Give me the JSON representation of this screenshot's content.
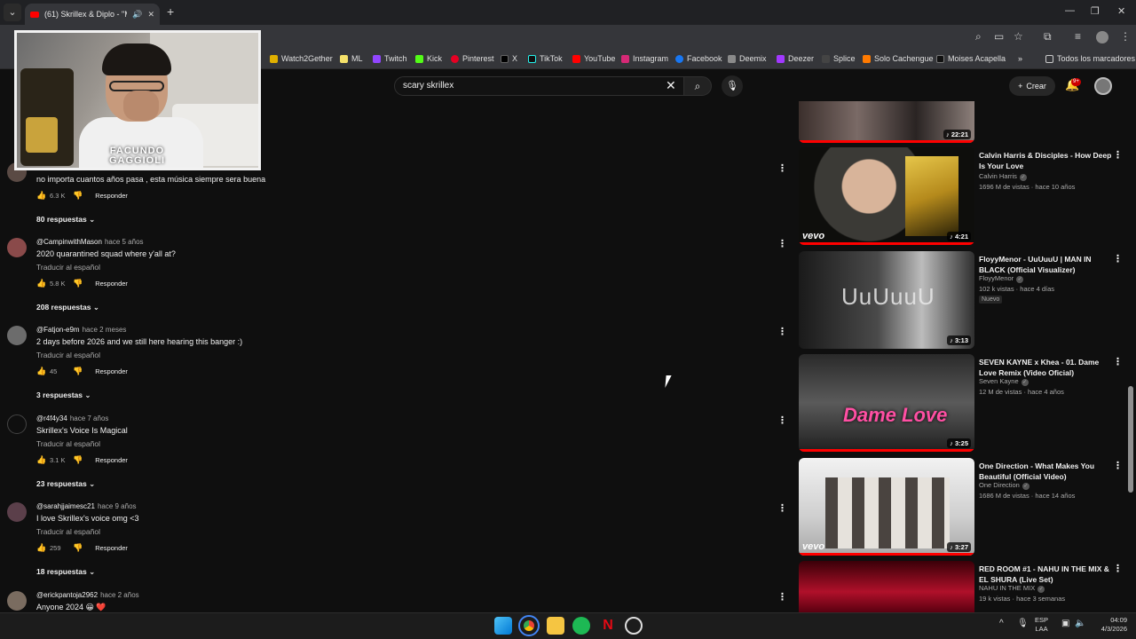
{
  "browser": {
    "tab_title": "(61) Skrillex & Diplo - \"Mind",
    "bookmarks": [
      "Watch2Gether",
      "ML",
      "Twitch",
      "Kick",
      "Pinterest",
      "X",
      "TikTok",
      "YouTube",
      "Instagram",
      "Facebook",
      "Deemix",
      "Deezer",
      "Splice",
      "Solo Cachengue",
      "Moises Acapella"
    ],
    "all_bookmarks": "Todos los marcadores"
  },
  "youtube": {
    "search_value": "scary skrillex",
    "create_label": "Crear",
    "notification_badge": "9+"
  },
  "webcam": {
    "name_line1": "FACUNDO",
    "name_line2": "GAGGIOLI"
  },
  "comments": [
    {
      "user": "",
      "time": "",
      "text": "no importa cuantos años pasa , esta música siempre sera buena",
      "translate": "",
      "likes": "6.3 K",
      "reply": "Responder",
      "replies": "80 respuestas"
    },
    {
      "user": "@CampinwithMason",
      "time": "hace 5 años",
      "text": "2020 quarantined squad where y'all at?",
      "translate": "Traducir al español",
      "likes": "5.8 K",
      "reply": "Responder",
      "replies": "208 respuestas"
    },
    {
      "user": "@Fatjon-e9m",
      "time": "hace 2 meses",
      "text": "2 days before 2026 and we still here hearing this banger :)",
      "translate": "Traducir al español",
      "likes": "45",
      "reply": "Responder",
      "replies": "3 respuestas"
    },
    {
      "user": "@r4f4y34",
      "time": "hace 7 años",
      "text": "Skrillex's Voice Is Magical",
      "translate": "Traducir al español",
      "likes": "3.1 K",
      "reply": "Responder",
      "replies": "23 respuestas"
    },
    {
      "user": "@sarahjjaimesc21",
      "time": "hace 9 años",
      "text": "I love Skrillex's voice omg <3",
      "translate": "Traducir al español",
      "likes": "259",
      "reply": "Responder",
      "replies": "18 respuestas"
    },
    {
      "user": "@erickpantoja2962",
      "time": "hace 2 años",
      "text": "Anyone 2024 😀 ❤️",
      "translate": "",
      "likes": "",
      "reply": "",
      "replies": ""
    }
  ],
  "sidebar": [
    {
      "title": "",
      "channel": "",
      "views": "",
      "duration": "22:21"
    },
    {
      "title": "Calvin Harris & Disciples - How Deep Is Your Love",
      "channel": "Calvin Harris",
      "views": "1696 M de vistas · hace 10 años",
      "duration": "4:21"
    },
    {
      "title": "FloyyMenor - UuUuuU | MAN IN BLACK (Official Visualizer)",
      "channel": "FloyyMenor",
      "views": "102 k vistas · hace 4 días",
      "badge": "Nuevo",
      "duration": "3:13",
      "thumb_text": "UuUuuU"
    },
    {
      "title": "SEVEN KAYNE x Khea - 01. Dame Love Remix (Video Oficial)",
      "channel": "Seven Kayne",
      "views": "12 M de vistas · hace 4 años",
      "duration": "3:25",
      "thumb_text": "Dame Love"
    },
    {
      "title": "One Direction - What Makes You Beautiful (Official Video)",
      "channel": "One Direction",
      "views": "1686 M de vistas · hace 14 años",
      "duration": "3:27"
    },
    {
      "title": "RED ROOM #1 - NAHU IN THE MIX & EL SHURA (Live Set)",
      "channel": "NAHU IN THE MIX",
      "views": "19 k vistas · hace 3 semanas",
      "duration": ""
    }
  ],
  "tray": {
    "lang_line1": "ESP",
    "lang_line2": "LAA",
    "time": "04:09",
    "date": "4/3/2026"
  },
  "colors": {
    "background": "#0f0f0f",
    "brand": "#ff0000",
    "text_secondary": "#aaaaaa"
  }
}
